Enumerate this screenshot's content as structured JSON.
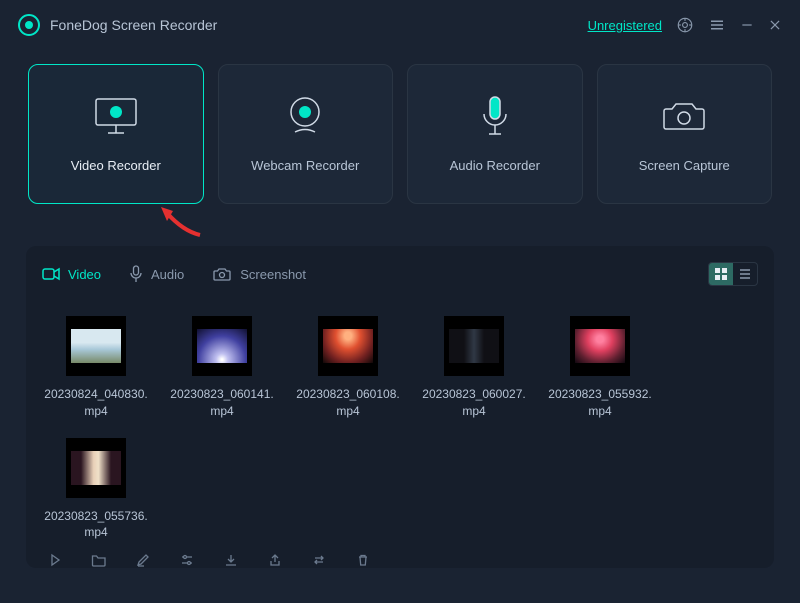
{
  "header": {
    "app_title": "FoneDog Screen Recorder",
    "unregistered_label": "Unregistered"
  },
  "modes": {
    "video": "Video Recorder",
    "webcam": "Webcam Recorder",
    "audio": "Audio Recorder",
    "capture": "Screen Capture"
  },
  "tabs": {
    "video": "Video",
    "audio": "Audio",
    "screenshot": "Screenshot"
  },
  "files": [
    {
      "name": "20230824_040830.mp4",
      "thumb_class": "t1"
    },
    {
      "name": "20230823_060141.mp4",
      "thumb_class": "t2"
    },
    {
      "name": "20230823_060108.mp4",
      "thumb_class": "t3"
    },
    {
      "name": "20230823_060027.mp4",
      "thumb_class": "t4"
    },
    {
      "name": "20230823_055932.mp4",
      "thumb_class": "t5"
    },
    {
      "name": "20230823_055736.mp4",
      "thumb_class": "t6"
    }
  ],
  "toolbar_icons": [
    "play",
    "folder",
    "edit",
    "settings",
    "download",
    "share",
    "link",
    "delete"
  ]
}
